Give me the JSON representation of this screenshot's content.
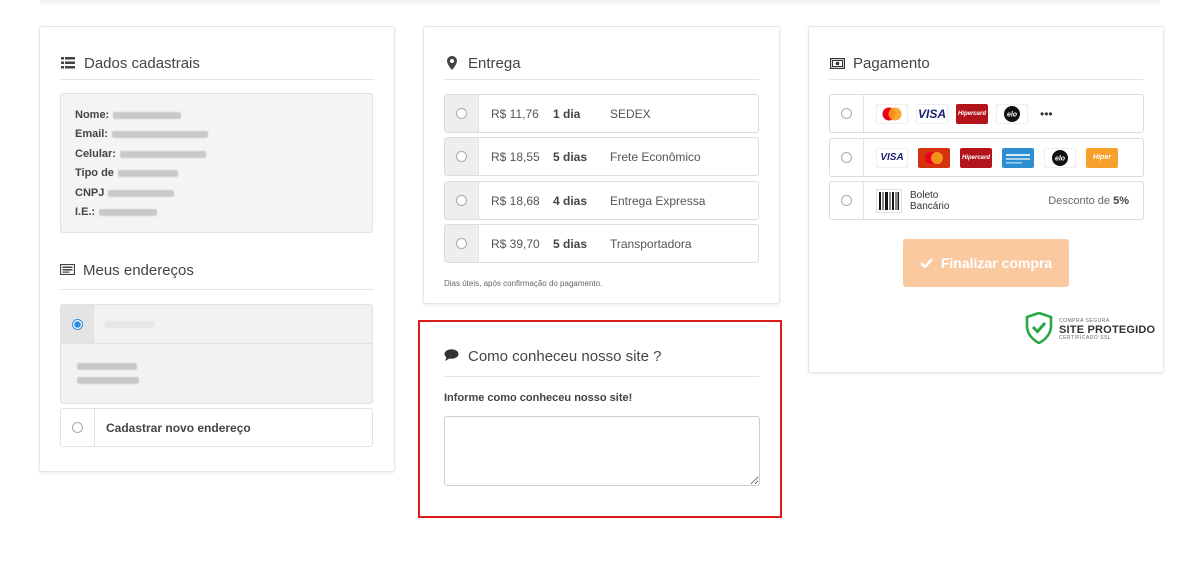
{
  "dados": {
    "title": "Dados cadastrais",
    "fields": [
      {
        "label": "Nome:"
      },
      {
        "label": "Email:"
      },
      {
        "label": "Celular:"
      },
      {
        "label": "Tipo de"
      },
      {
        "label": "CNPJ"
      },
      {
        "label": "I.E.:"
      }
    ]
  },
  "enderecos": {
    "title": "Meus endereços",
    "new_label": "Cadastrar novo endereço"
  },
  "entrega": {
    "title": "Entrega",
    "options": [
      {
        "price": "R$ 11,76",
        "days": "1 dia",
        "name": "SEDEX"
      },
      {
        "price": "R$ 18,55",
        "days": "5 dias",
        "name": "Frete Econômico"
      },
      {
        "price": "R$ 18,68",
        "days": "4 dias",
        "name": "Entrega Expressa"
      },
      {
        "price": "R$ 39,70",
        "days": "5 dias",
        "name": "Transportadora"
      }
    ],
    "note": "Dias úteis, após confirmação do pagamento."
  },
  "como": {
    "title": "Como conheceu nosso site ?",
    "label": "Informe como conheceu nosso site!"
  },
  "pagamento": {
    "title": "Pagamento",
    "more": "•••",
    "boleto_line1": "Boleto",
    "boleto_line2": "Bancário",
    "desconto_prefix": "Desconto de",
    "desconto_value": "5%",
    "finalizar": "Finalizar compra",
    "seal_top": "COMPRA SEGURA",
    "seal_main": "SITE PROTEGIDO",
    "seal_bottom": "CERTIFICADO SSL",
    "visa": "VISA",
    "hipercard": "Hipercard",
    "elo": "elo",
    "hiper": "Hiper"
  }
}
